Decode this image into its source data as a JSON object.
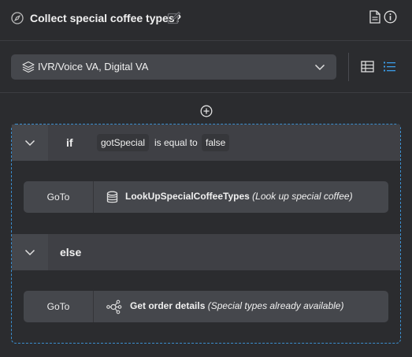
{
  "header": {
    "title": "Collect special coffee types?",
    "icons": [
      "compass-icon",
      "edit-icon",
      "document-icon",
      "info-icon"
    ]
  },
  "toolbar": {
    "channel": "IVR/Voice VA, Digital VA",
    "icons": [
      "layers-icon",
      "chevron-down-icon",
      "table-view-icon",
      "list-view-icon"
    ],
    "active_view": "list"
  },
  "branches": {
    "if": {
      "keyword": "if",
      "variable": "gotSpecial",
      "operator": "is equal to",
      "value": "false",
      "action": {
        "type": "GoTo",
        "target": "LookUpSpecialCoffeeTypes",
        "description": "(Look up special coffee)"
      }
    },
    "else": {
      "keyword": "else",
      "action": {
        "type": "GoTo",
        "target": "Get order details",
        "description": "(Special types already available)"
      }
    }
  },
  "colors": {
    "background": "#2b2c2f",
    "panel": "#45474c",
    "branch_header": "#3f4045",
    "accent": "#3b8fd0"
  }
}
